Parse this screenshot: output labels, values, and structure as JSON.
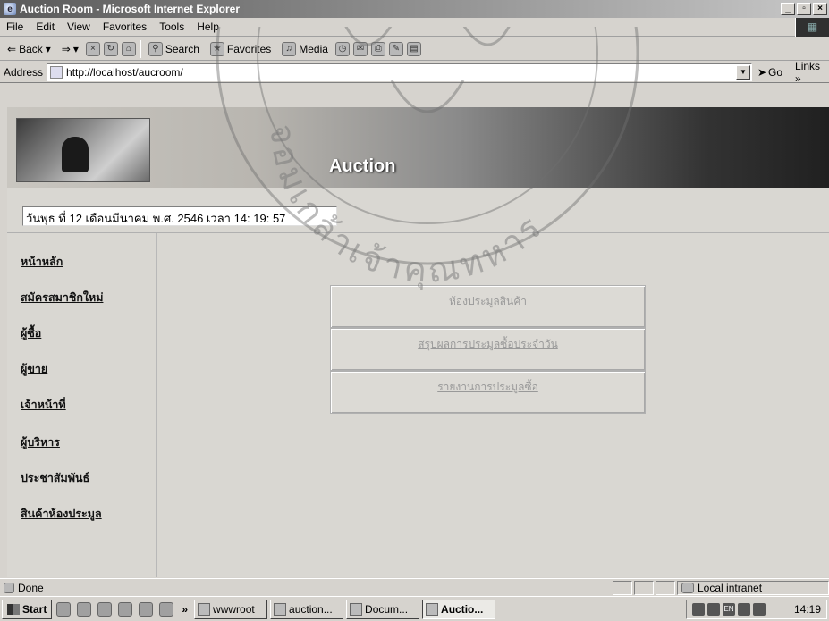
{
  "window": {
    "title": "Auction Room - Microsoft Internet Explorer",
    "buttons": [
      "_",
      "\b",
      "×"
    ]
  },
  "menu": [
    "File",
    "Edit",
    "View",
    "Favorites",
    "Tools",
    "Help"
  ],
  "toolbar": {
    "back": "Back",
    "search": "Search",
    "favorites": "Favorites",
    "media": "Media"
  },
  "address": {
    "label": "Address",
    "url": "http://localhost/aucroom/",
    "go": "Go",
    "links": "Links"
  },
  "banner": {
    "title": "Auction"
  },
  "page": {
    "datetime": "วันพุธ ที่ 12 เดือนมีนาคม พ.ศ. 2546 เวลา 14: 19: 57",
    "nav": [
      "หน้าหลัก",
      "สมัครสมาชิกใหม่",
      "ผู้ซื้อ",
      "ผู้ขาย",
      "เจ้าหน้าที่",
      "ผู้บริหาร",
      "ประชาสัมพันธ์",
      "สินค้าห้องประมูล"
    ],
    "buttons": [
      "ห้องประมูลสินค้า",
      "สรุปผลการประมูลซื้อประจำวัน",
      "รายงานการประมูลซื้อ"
    ],
    "watermark": "จอมเกล้าเจ้าคุณทหาร"
  },
  "status": {
    "text": "Done",
    "zone": "Local intranet"
  },
  "taskbar": {
    "start": "Start",
    "chevron": "»",
    "tasks": [
      "wwwroot",
      "auction...",
      "Docum...",
      "Auctio..."
    ],
    "clock": "14:19",
    "lang": "EN"
  }
}
